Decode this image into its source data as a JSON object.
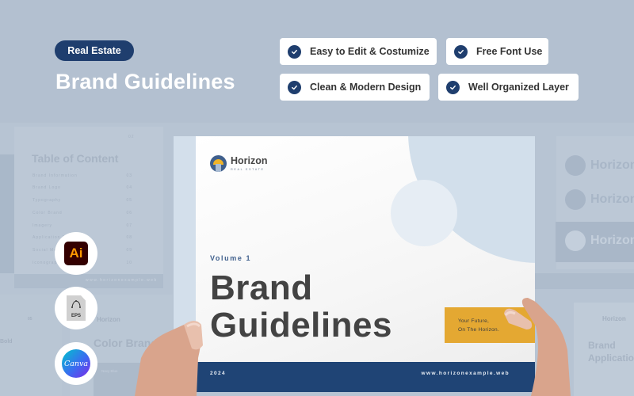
{
  "header": {
    "category_tag": "Real Estate",
    "title": "Brand Guidelines"
  },
  "features": [
    {
      "icon": "check-circle-icon",
      "label": "Easy to Edit & Costumize"
    },
    {
      "icon": "check-circle-icon",
      "label": "Free Font Use"
    },
    {
      "icon": "check-circle-icon",
      "label": "Clean & Modern Design"
    },
    {
      "icon": "check-circle-icon",
      "label": "Well Organized Layer"
    }
  ],
  "software_icons": [
    {
      "name": "adobe-illustrator",
      "label": "Ai"
    },
    {
      "name": "eps-file",
      "label": "EPS"
    },
    {
      "name": "canva",
      "label": "Canva"
    }
  ],
  "cover": {
    "brand_name": "Horizon",
    "brand_subtitle": "REAL ESTATE",
    "volume": "Volume 1",
    "title_line1": "Brand",
    "title_line2": "Guidelines",
    "tagline_line1": "Your Future,",
    "tagline_line2": "On The Horizon.",
    "year": "2024",
    "website": "www.horizonexample.web",
    "colors": {
      "navy": "#1f4475",
      "accent_yellow": "#e4a832",
      "light_blue": "#d2dfeb"
    }
  },
  "background_pages": {
    "toc": {
      "page_number": "02",
      "title": "Table of Content",
      "items": [
        {
          "label": "Brand Information",
          "page": "03"
        },
        {
          "label": "Brand Logo",
          "page": "04"
        },
        {
          "label": "Typography",
          "page": "05"
        },
        {
          "label": "Color Brand",
          "page": "06"
        },
        {
          "label": "Imagery",
          "page": "07"
        },
        {
          "label": "Application Brand",
          "page": "08"
        },
        {
          "label": "Social Media",
          "page": "09"
        },
        {
          "label": "Iconography",
          "page": "10"
        }
      ],
      "footer_url": "www.horizonexample.web"
    },
    "color_brand_title": "Color Brand",
    "color_brand_page": "05",
    "swatch_label": "Navy Blue",
    "bold_label": "Bold",
    "brand_application_title_line1": "Brand",
    "brand_application_title_line2": "Application",
    "logo_word": "Horizon"
  }
}
